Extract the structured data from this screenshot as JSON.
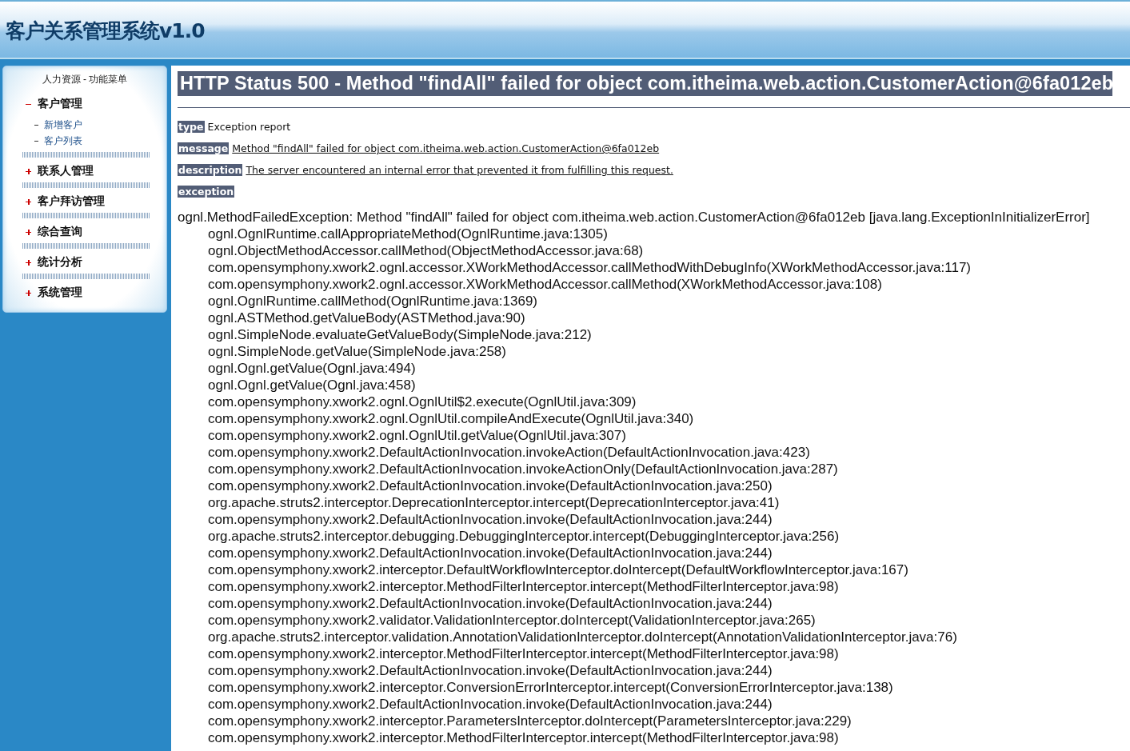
{
  "header": {
    "title": "客户关系管理系统v1.0"
  },
  "sidebar": {
    "title": "人力资源 - 功能菜单",
    "items": [
      {
        "label": "客户管理",
        "expanded": true,
        "children": [
          {
            "label": "新增客户"
          },
          {
            "label": "客户列表"
          }
        ]
      },
      {
        "label": "联系人管理",
        "expanded": false
      },
      {
        "label": "客户拜访管理",
        "expanded": false
      },
      {
        "label": "综合查询",
        "expanded": false
      },
      {
        "label": "统计分析",
        "expanded": false
      },
      {
        "label": "系统管理",
        "expanded": false
      }
    ]
  },
  "error": {
    "heading": "HTTP Status 500 - Method \"findAll\" failed for object com.itheima.web.action.CustomerAction@6fa012eb",
    "fields": [
      {
        "label": "type",
        "value": "Exception report",
        "kind": "plain"
      },
      {
        "label": "message",
        "value": "Method \"findAll\" failed for object com.itheima.web.action.CustomerAction@6fa012eb",
        "kind": "underlined"
      },
      {
        "label": "description",
        "value": "The server encountered an internal error that prevented it from fulfilling this request.",
        "kind": "underlined"
      },
      {
        "label": "exception"
      }
    ],
    "exception_line": "ognl.MethodFailedException: Method \"findAll\" failed for object com.itheima.web.action.CustomerAction@6fa012eb [java.lang.ExceptionInInitializerError]",
    "stack_trace": [
      "ognl.OgnlRuntime.callAppropriateMethod(OgnlRuntime.java:1305)",
      "ognl.ObjectMethodAccessor.callMethod(ObjectMethodAccessor.java:68)",
      "com.opensymphony.xwork2.ognl.accessor.XWorkMethodAccessor.callMethodWithDebugInfo(XWorkMethodAccessor.java:117)",
      "com.opensymphony.xwork2.ognl.accessor.XWorkMethodAccessor.callMethod(XWorkMethodAccessor.java:108)",
      "ognl.OgnlRuntime.callMethod(OgnlRuntime.java:1369)",
      "ognl.ASTMethod.getValueBody(ASTMethod.java:90)",
      "ognl.SimpleNode.evaluateGetValueBody(SimpleNode.java:212)",
      "ognl.SimpleNode.getValue(SimpleNode.java:258)",
      "ognl.Ognl.getValue(Ognl.java:494)",
      "ognl.Ognl.getValue(Ognl.java:458)",
      "com.opensymphony.xwork2.ognl.OgnlUtil$2.execute(OgnlUtil.java:309)",
      "com.opensymphony.xwork2.ognl.OgnlUtil.compileAndExecute(OgnlUtil.java:340)",
      "com.opensymphony.xwork2.ognl.OgnlUtil.getValue(OgnlUtil.java:307)",
      "com.opensymphony.xwork2.DefaultActionInvocation.invokeAction(DefaultActionInvocation.java:423)",
      "com.opensymphony.xwork2.DefaultActionInvocation.invokeActionOnly(DefaultActionInvocation.java:287)",
      "com.opensymphony.xwork2.DefaultActionInvocation.invoke(DefaultActionInvocation.java:250)",
      "org.apache.struts2.interceptor.DeprecationInterceptor.intercept(DeprecationInterceptor.java:41)",
      "com.opensymphony.xwork2.DefaultActionInvocation.invoke(DefaultActionInvocation.java:244)",
      "org.apache.struts2.interceptor.debugging.DebuggingInterceptor.intercept(DebuggingInterceptor.java:256)",
      "com.opensymphony.xwork2.DefaultActionInvocation.invoke(DefaultActionInvocation.java:244)",
      "com.opensymphony.xwork2.interceptor.DefaultWorkflowInterceptor.doIntercept(DefaultWorkflowInterceptor.java:167)",
      "com.opensymphony.xwork2.interceptor.MethodFilterInterceptor.intercept(MethodFilterInterceptor.java:98)",
      "com.opensymphony.xwork2.DefaultActionInvocation.invoke(DefaultActionInvocation.java:244)",
      "com.opensymphony.xwork2.validator.ValidationInterceptor.doIntercept(ValidationInterceptor.java:265)",
      "org.apache.struts2.interceptor.validation.AnnotationValidationInterceptor.doIntercept(AnnotationValidationInterceptor.java:76)",
      "com.opensymphony.xwork2.interceptor.MethodFilterInterceptor.intercept(MethodFilterInterceptor.java:98)",
      "com.opensymphony.xwork2.DefaultActionInvocation.invoke(DefaultActionInvocation.java:244)",
      "com.opensymphony.xwork2.interceptor.ConversionErrorInterceptor.intercept(ConversionErrorInterceptor.java:138)",
      "com.opensymphony.xwork2.DefaultActionInvocation.invoke(DefaultActionInvocation.java:244)",
      "com.opensymphony.xwork2.interceptor.ParametersInterceptor.doIntercept(ParametersInterceptor.java:229)",
      "com.opensymphony.xwork2.interceptor.MethodFilterInterceptor.intercept(MethodFilterInterceptor.java:98)"
    ]
  }
}
